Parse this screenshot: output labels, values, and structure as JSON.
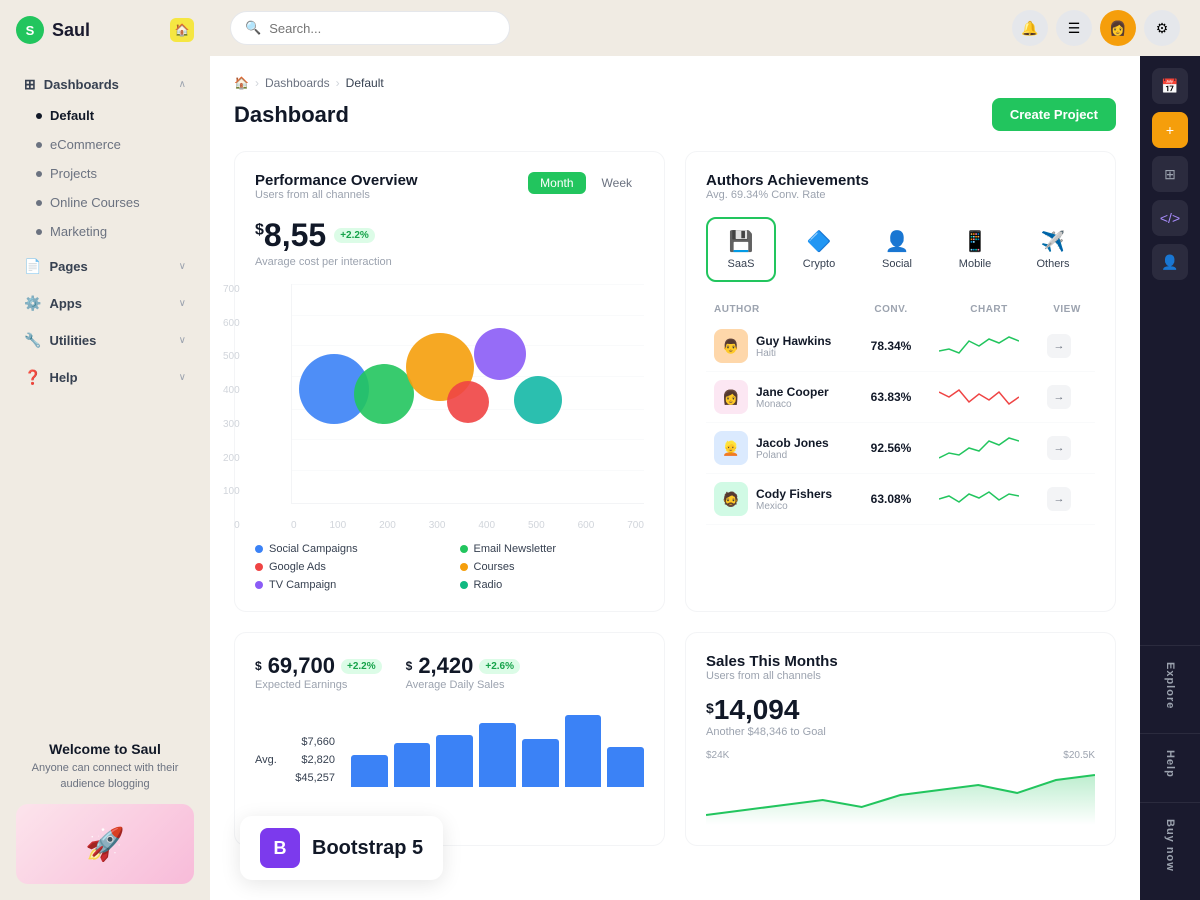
{
  "app": {
    "name": "Saul",
    "logo_letter": "S"
  },
  "header": {
    "search_placeholder": "Search...",
    "search_value": ""
  },
  "sidebar": {
    "items": [
      {
        "id": "dashboards",
        "label": "Dashboards",
        "type": "group",
        "expanded": true
      },
      {
        "id": "default",
        "label": "Default",
        "type": "child",
        "active": true
      },
      {
        "id": "ecommerce",
        "label": "eCommerce",
        "type": "child"
      },
      {
        "id": "projects",
        "label": "Projects",
        "type": "child"
      },
      {
        "id": "online-courses",
        "label": "Online Courses",
        "type": "child"
      },
      {
        "id": "marketing",
        "label": "Marketing",
        "type": "child"
      },
      {
        "id": "pages",
        "label": "Pages",
        "type": "group"
      },
      {
        "id": "apps",
        "label": "Apps",
        "type": "group"
      },
      {
        "id": "utilities",
        "label": "Utilities",
        "type": "group"
      },
      {
        "id": "help",
        "label": "Help",
        "type": "group"
      }
    ],
    "welcome_title": "Welcome to Saul",
    "welcome_sub": "Anyone can connect with their audience blogging"
  },
  "breadcrumb": {
    "home": "🏠",
    "items": [
      "Dashboards",
      "Default"
    ]
  },
  "page": {
    "title": "Dashboard",
    "create_button": "Create Project"
  },
  "performance": {
    "title": "Performance Overview",
    "subtitle": "Users from all channels",
    "tabs": [
      {
        "label": "Month",
        "active": true
      },
      {
        "label": "Week",
        "active": false
      }
    ],
    "value": "8,55",
    "value_prefix": "$",
    "badge": "+2.2%",
    "value_label": "Avarage cost per interaction",
    "y_labels": [
      "700",
      "600",
      "500",
      "400",
      "300",
      "200",
      "100",
      "0"
    ],
    "x_labels": [
      "0",
      "100",
      "200",
      "300",
      "400",
      "500",
      "600",
      "700"
    ],
    "legend": [
      {
        "label": "Social Campaigns",
        "color": "#3b82f6"
      },
      {
        "label": "Email Newsletter",
        "color": "#22c55e"
      },
      {
        "label": "Google Ads",
        "color": "#ef4444"
      },
      {
        "label": "Courses",
        "color": "#f59e0b"
      },
      {
        "label": "TV Campaign",
        "color": "#8b5cf6"
      },
      {
        "label": "Radio",
        "color": "#10b981"
      }
    ]
  },
  "authors": {
    "title": "Authors Achievements",
    "subtitle": "Avg. 69.34% Conv. Rate",
    "tabs": [
      {
        "label": "SaaS",
        "icon": "💾",
        "active": true
      },
      {
        "label": "Crypto",
        "icon": "🔷",
        "active": false
      },
      {
        "label": "Social",
        "icon": "👤",
        "active": false
      },
      {
        "label": "Mobile",
        "icon": "📱",
        "active": false
      },
      {
        "label": "Others",
        "icon": "✈️",
        "active": false
      }
    ],
    "table_headers": [
      "AUTHOR",
      "CONV.",
      "CHART",
      "VIEW"
    ],
    "rows": [
      {
        "name": "Guy Hawkins",
        "country": "Haiti",
        "conv": "78.34%",
        "chart_color": "#22c55e",
        "avatar": "👨"
      },
      {
        "name": "Jane Cooper",
        "country": "Monaco",
        "conv": "63.83%",
        "chart_color": "#ef4444",
        "avatar": "👩"
      },
      {
        "name": "Jacob Jones",
        "country": "Poland",
        "conv": "92.56%",
        "chart_color": "#22c55e",
        "avatar": "👱"
      },
      {
        "name": "Cody Fishers",
        "country": "Mexico",
        "conv": "63.08%",
        "chart_color": "#22c55e",
        "avatar": "🧔"
      }
    ]
  },
  "earnings": {
    "expected_value": "69,700",
    "expected_prefix": "$",
    "expected_badge": "+2.2%",
    "expected_label": "Expected Earnings",
    "daily_value": "2,420",
    "daily_prefix": "$",
    "daily_badge": "+2.6%",
    "daily_label": "Average Daily Sales",
    "sales_rows": [
      {
        "label": "",
        "value": "$7,660"
      },
      {
        "label": "Avg.",
        "value": "$2,820"
      },
      {
        "label": "",
        "value": "$45,257"
      }
    ],
    "bars": [
      40,
      55,
      65,
      70,
      60,
      80,
      45
    ]
  },
  "sales_month": {
    "title": "Sales This Months",
    "subtitle": "Users from all channels",
    "value": "14,094",
    "value_prefix": "$",
    "goal_text": "Another $48,346 to Goal",
    "y_labels": [
      "$24K",
      "$20.5K"
    ]
  },
  "right_panel": {
    "labels": [
      "Explore",
      "Help",
      "Buy now"
    ]
  },
  "bootstrap": {
    "icon": "B",
    "text": "Bootstrap 5"
  }
}
